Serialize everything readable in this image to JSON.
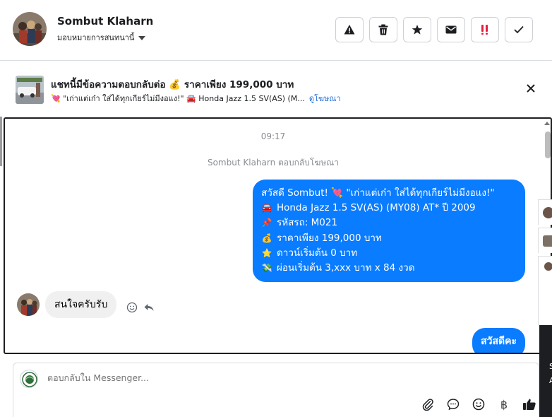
{
  "header": {
    "contact_name": "Sombut Klaharn",
    "assign_label": "มอบหมายการสนทนานี้",
    "actions": [
      "report-icon",
      "trash-icon",
      "star-icon",
      "mail-icon",
      "priority-icon",
      "check-icon"
    ]
  },
  "banner": {
    "title": "แชทนี้มีข้อความตอบกลับต่อ 💰 ราคาเพียง 199,000 บาท",
    "subtitle": "💘 \"เก่าแต่เก๋า ใส่ได้ทุกเกียร์ไม่มีงอแง!\" 🚘 Honda Jazz 1.5 SV(AS) (M...",
    "link": "ดูโฆษณา"
  },
  "conversation": {
    "timestamp": "09:17",
    "ad_reply_note": "Sombut Klaharn ตอบกลับโฆษณา",
    "outgoing_ad_message": [
      {
        "icon": "",
        "text": "สวัสดี Sombut! 💘 \"เก่าแต่เก๋า ใส่ได้ทุกเกียร์ไม่มีงอแง!\""
      },
      {
        "icon": "🚘",
        "text": " Honda Jazz 1.5 SV(AS) (MY08) AT* ปี 2009"
      },
      {
        "icon": "📌",
        "text": "รหัสรถ: M021"
      },
      {
        "icon": "💰",
        "text": "ราคาเพียง 199,000 บาท"
      },
      {
        "icon": "⭐",
        "text": "ดาวน์เริ่มต้น 0 บาท"
      },
      {
        "icon": "💸",
        "text": "ผ่อนเริ่มต้น 3,xxx บาท x 84 งวด"
      }
    ],
    "incoming_message": "สนใจครับรับ",
    "outgoing_reply": "สวัสดีคะ"
  },
  "composer": {
    "placeholder": "ตอบกลับใน Messenger...",
    "tools": [
      "attachment-icon",
      "saved-reply-icon",
      "emoji-icon",
      "baht-icon",
      "like-icon"
    ],
    "baht_symbol": "฿"
  },
  "side_panel": {
    "letters": [
      "S",
      "A"
    ]
  }
}
